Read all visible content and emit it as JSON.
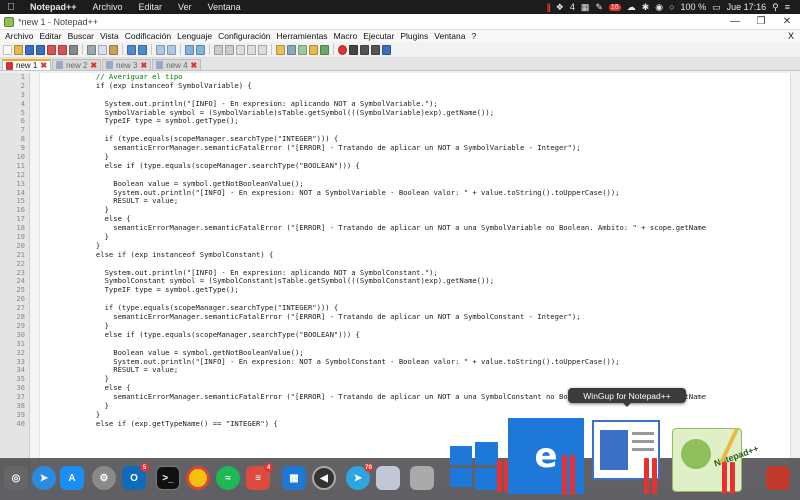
{
  "menubar": {
    "app_name": "Notepad++",
    "items": [
      "Archivo",
      "Editar",
      "Ver",
      "Ventana"
    ],
    "status_icons": [
      "4",
      "16",
      "100 %"
    ],
    "clock": "Jue 17:16"
  },
  "window": {
    "title": "*new 1 - Notepad++",
    "menu": [
      "Archivo",
      "Editar",
      "Buscar",
      "Vista",
      "Codificación",
      "Lenguaje",
      "Configuración",
      "Herramientas",
      "Macro",
      "Ejecutar",
      "Plugins",
      "Ventana",
      "?"
    ],
    "menu_close": "X",
    "tabs": [
      {
        "label": "new 1",
        "active": true
      },
      {
        "label": "new 2",
        "active": false
      },
      {
        "label": "new 3",
        "active": false
      },
      {
        "label": "new 4",
        "active": false
      }
    ]
  },
  "editor": {
    "lines": [
      {
        "n": "1",
        "text": "            // Averiguar el tipo"
      },
      {
        "n": "2",
        "text": "            if (exp instanceof SymbolVariable) {"
      },
      {
        "n": "3",
        "text": ""
      },
      {
        "n": "4",
        "text": "              System.out.println(\"[INFO] - En expresion: aplicando NOT a SymbolVariable.\");"
      },
      {
        "n": "5",
        "text": "              SymbolVariable symbol = (SymbolVariable)sTable.getSymbol(((SymbolVariable)exp).getName());"
      },
      {
        "n": "6",
        "text": "              TypeIF type = symbol.getType();"
      },
      {
        "n": "7",
        "text": ""
      },
      {
        "n": "8",
        "text": "              if (type.equals(scopeManager.searchType(\"INTEGER\"))) {"
      },
      {
        "n": "9",
        "text": "                semanticErrorManager.semanticFatalError (\"[ERROR] - Tratando de aplicar un NOT a SymbolVariable - Integer\");"
      },
      {
        "n": "10",
        "text": "              }"
      },
      {
        "n": "11",
        "text": "              else if (type.equals(scopeManager.searchType(\"BOOLEAN\"))) {"
      },
      {
        "n": "12",
        "text": ""
      },
      {
        "n": "13",
        "text": "                Boolean value = symbol.getNotBooleanValue();"
      },
      {
        "n": "14",
        "text": "                System.out.println(\"[INFO] - En expresion: NOT a SymbolVariable - Boolean valor: \" + value.toString().toUpperCase());"
      },
      {
        "n": "15",
        "text": "                RESULT = value;"
      },
      {
        "n": "16",
        "text": "              }"
      },
      {
        "n": "17",
        "text": "              else {"
      },
      {
        "n": "18",
        "text": "                semanticErrorManager.semanticFatalError (\"[ERROR] - Tratando de aplicar un NOT a una SymbolVariable no Boolean. Ambito: \" + scope.getName"
      },
      {
        "n": "19",
        "text": "              }"
      },
      {
        "n": "20",
        "text": "            }"
      },
      {
        "n": "21",
        "text": "            else if (exp instanceof SymbolConstant) {"
      },
      {
        "n": "22",
        "text": ""
      },
      {
        "n": "23",
        "text": "              System.out.println(\"[INFO] - En expresion: aplicando NOT a SymbolConstant.\");"
      },
      {
        "n": "24",
        "text": "              SymbolConstant symbol = (SymbolConstant)sTable.getSymbol(((SymbolConstant)exp).getName());"
      },
      {
        "n": "25",
        "text": "              TypeIF type = symbol.getType();"
      },
      {
        "n": "26",
        "text": ""
      },
      {
        "n": "27",
        "text": "              if (type.equals(scopeManager.searchType(\"INTEGER\"))) {"
      },
      {
        "n": "28",
        "text": "                semanticErrorManager.semanticFatalError (\"[ERROR] - Tratando de aplicar un NOT a SymbolConstant - Integer\");"
      },
      {
        "n": "29",
        "text": "              }"
      },
      {
        "n": "30",
        "text": "              else if (type.equals(scopeManager.searchType(\"BOOLEAN\"))) {"
      },
      {
        "n": "31",
        "text": ""
      },
      {
        "n": "32",
        "text": "                Boolean value = symbol.getNotBooleanValue();"
      },
      {
        "n": "33",
        "text": "                System.out.println(\"[INFO] - En expresion: NOT a SymbolConstant - Boolean valor: \" + value.toString().toUpperCase());"
      },
      {
        "n": "34",
        "text": "                RESULT = value;"
      },
      {
        "n": "35",
        "text": "              }"
      },
      {
        "n": "36",
        "text": "              else {"
      },
      {
        "n": "37",
        "text": "                semanticErrorManager.semanticFatalError (\"[ERROR] - Tratando de aplicar un NOT a una SymbolConstant no Boolean. Ambito: \" + scope.getName"
      },
      {
        "n": "38",
        "text": "              }"
      },
      {
        "n": "39",
        "text": "            }"
      },
      {
        "n": "40",
        "text": "            else if (exp.getTypeName() == \"INTEGER\") {"
      }
    ]
  },
  "tooltip": "WinGup for Notepad++",
  "dock": {
    "mail_badge": "5",
    "todo_badge": "4",
    "telegram_badge": "70",
    "preview_label": "Notepad++"
  },
  "colors": {
    "accent": "#f5a623",
    "notification_red": "#e8322f",
    "windows_blue": "#1e78d7"
  }
}
